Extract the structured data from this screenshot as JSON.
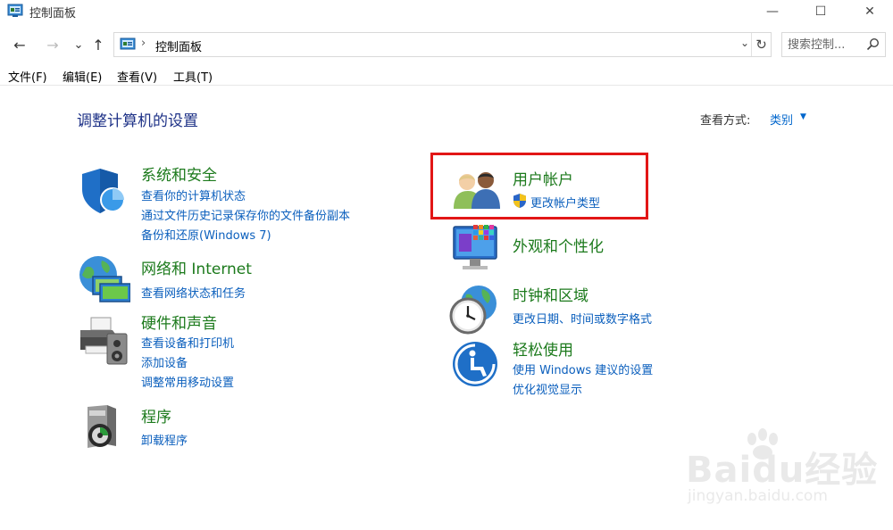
{
  "window": {
    "title": "控制面板",
    "minimize_glyph": "—",
    "maximize_glyph": "☐",
    "close_glyph": "✕"
  },
  "nav": {
    "back_glyph": "←",
    "forward_glyph": "→",
    "recent_glyph": "⌄",
    "up_glyph": "↑",
    "address_separator": "›",
    "breadcrumb": "控制面板",
    "dropdown_glyph": "⌄",
    "refresh_glyph": "↻",
    "search_placeholder": "搜索控制..."
  },
  "menu": {
    "items": [
      "文件(F)",
      "编辑(E)",
      "查看(V)",
      "工具(T)"
    ]
  },
  "main": {
    "title": "调整计算机的设置",
    "view_by_label": "查看方式:",
    "view_by_value": "类别",
    "view_by_arrow": "▼"
  },
  "categories": {
    "security": {
      "title": "系统和安全",
      "links": [
        "查看你的计算机状态",
        "通过文件历史记录保存你的文件备份副本",
        "备份和还原(Windows 7)"
      ]
    },
    "network": {
      "title": "网络和 Internet",
      "links": [
        "查看网络状态和任务"
      ]
    },
    "hardware": {
      "title": "硬件和声音",
      "links": [
        "查看设备和打印机",
        "添加设备",
        "调整常用移动设置"
      ]
    },
    "programs": {
      "title": "程序",
      "links": [
        "卸载程序"
      ]
    },
    "users": {
      "title": "用户帐户",
      "links": [
        "更改帐户类型"
      ]
    },
    "appearance": {
      "title": "外观和个性化",
      "links": []
    },
    "clock": {
      "title": "时钟和区域",
      "links": [
        "更改日期、时间或数字格式"
      ]
    },
    "ease": {
      "title": "轻松使用",
      "links": [
        "使用 Windows 建议的设置",
        "优化视觉显示"
      ]
    }
  },
  "watermark": {
    "logo": "Baidu经验",
    "url": "jingyan.baidu.com"
  },
  "colors": {
    "category_title": "#1c7a1c",
    "link": "#0b5fbd",
    "page_title": "#1e3287",
    "highlight": "#e21616"
  }
}
